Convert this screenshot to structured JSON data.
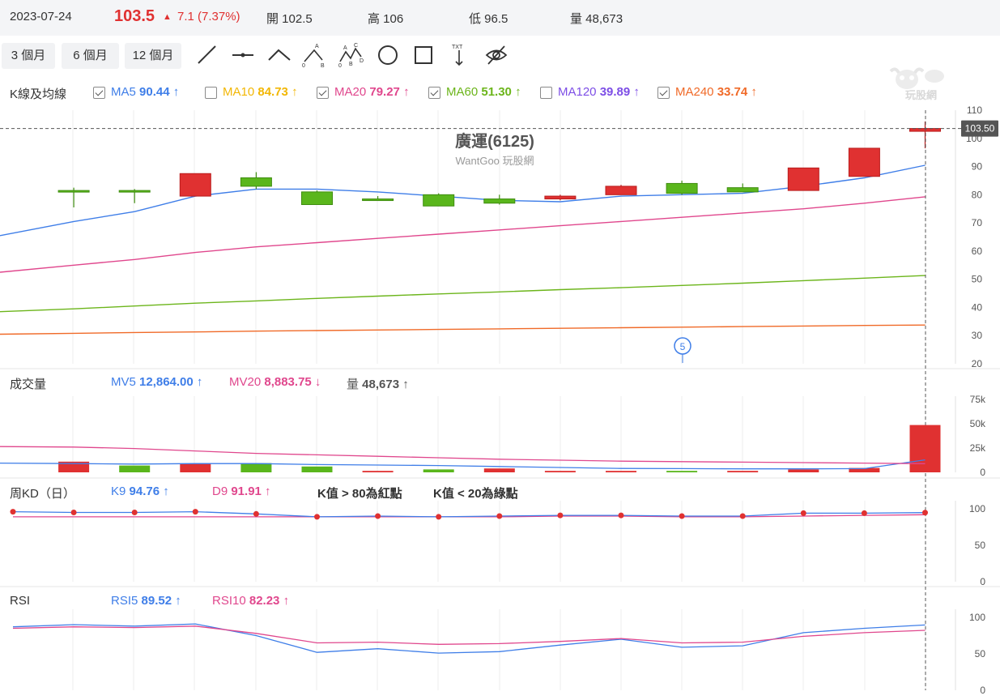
{
  "header": {
    "date": "2023-07-24",
    "price": "103.5",
    "change": "7.1 (7.37%)",
    "open": "開 102.5",
    "high": "高 106",
    "low": "低 96.5",
    "volume": "量 48,673"
  },
  "colors": {
    "up": "#e03131",
    "down": "#5ab61c",
    "ma5": "#3f7ee8",
    "ma20": "#e0478d",
    "ma60": "#6cb51b",
    "ma240": "#f06a28",
    "ma10": "#f2b705",
    "ma120": "#7d4ee6",
    "k": "#3f7ee8",
    "d": "#e0478d",
    "rsi5": "#3f7ee8",
    "rsi10": "#e0478d"
  },
  "toolbar": {
    "periods": [
      "3 個月",
      "6 個月",
      "12 個月"
    ],
    "tools": [
      "trend-line-icon",
      "horizontal-line-icon",
      "angle-line-icon",
      "abc-pattern-icon",
      "abcd-pattern-icon",
      "circle-icon",
      "rectangle-icon",
      "text-icon",
      "hide-icon"
    ]
  },
  "ma_legend": {
    "title": "K線及均線",
    "items": [
      {
        "label": "MA5",
        "value": "90.44",
        "arrow": "↑",
        "checked": true,
        "color": "#3f7ee8"
      },
      {
        "label": "MA10",
        "value": "84.73",
        "arrow": "↑",
        "checked": false,
        "color": "#f2b705"
      },
      {
        "label": "MA20",
        "value": "79.27",
        "arrow": "↑",
        "checked": true,
        "color": "#e0478d"
      },
      {
        "label": "MA60",
        "value": "51.30",
        "arrow": "↑",
        "checked": true,
        "color": "#6cb51b"
      },
      {
        "label": "MA120",
        "value": "39.89",
        "arrow": "↑",
        "checked": false,
        "color": "#7d4ee6"
      },
      {
        "label": "MA240",
        "value": "33.74",
        "arrow": "↑",
        "checked": true,
        "color": "#f06a28"
      }
    ]
  },
  "watermark": {
    "text": "玩股網"
  },
  "chart_data": [
    {
      "type": "candlestick",
      "title": "廣運(6125)",
      "subtitle": "WantGoo 玩股網",
      "ylim": [
        20,
        110
      ],
      "yticks": [
        110,
        100,
        90,
        80,
        70,
        60,
        50,
        40,
        30,
        20
      ],
      "last_price_label": "103.50",
      "last_price": 103.5,
      "event_marker": "5",
      "candles": [
        {
          "o": 81.5,
          "h": 82.5,
          "l": 75.5,
          "c": 81
        },
        {
          "o": 81.5,
          "h": 82,
          "l": 77,
          "c": 81
        },
        {
          "o": 79.5,
          "h": 87.5,
          "l": 79.5,
          "c": 87.5
        },
        {
          "o": 86,
          "h": 88,
          "l": 82,
          "c": 83
        },
        {
          "o": 81,
          "h": 81.5,
          "l": 76.5,
          "c": 76.5
        },
        {
          "o": 78.5,
          "h": 79.5,
          "l": 78,
          "c": 78.3
        },
        {
          "o": 80,
          "h": 80.5,
          "l": 76,
          "c": 76
        },
        {
          "o": 78.5,
          "h": 80,
          "l": 76.5,
          "c": 77
        },
        {
          "o": 78.5,
          "h": 80,
          "l": 78,
          "c": 79.5
        },
        {
          "o": 80,
          "h": 83.5,
          "l": 80,
          "c": 83
        },
        {
          "o": 84,
          "h": 85,
          "l": 80,
          "c": 80.5
        },
        {
          "o": 82.5,
          "h": 84,
          "l": 81,
          "c": 81
        },
        {
          "o": 81.5,
          "h": 89.5,
          "l": 81.5,
          "c": 89.5
        },
        {
          "o": 86.5,
          "h": 96.5,
          "l": 86.5,
          "c": 96.5
        },
        {
          "o": 102.5,
          "h": 106,
          "l": 96.5,
          "c": 103.5
        }
      ],
      "series": [
        {
          "name": "MA5",
          "values": [
            65.5,
            70.5,
            74,
            79.5,
            82,
            82,
            81,
            79.5,
            78,
            77.5,
            79.5,
            80,
            80.5,
            83,
            86,
            90.44
          ]
        },
        {
          "name": "MA20",
          "values": [
            52.5,
            55,
            57,
            59.5,
            61.5,
            63,
            64.5,
            66,
            67.5,
            69,
            70.5,
            72,
            73.5,
            75,
            77,
            79.27
          ]
        },
        {
          "name": "MA60",
          "values": [
            38.5,
            39.5,
            40.5,
            41.5,
            42.3,
            43.2,
            44,
            44.8,
            45.5,
            46.3,
            47,
            47.8,
            48.6,
            49.5,
            50.4,
            51.3
          ]
        },
        {
          "name": "MA240",
          "values": [
            30.5,
            30.8,
            31.1,
            31.3,
            31.6,
            31.8,
            32,
            32.2,
            32.4,
            32.6,
            32.8,
            33,
            33.2,
            33.4,
            33.6,
            33.74
          ]
        }
      ]
    },
    {
      "type": "bar",
      "title": "成交量",
      "legend": [
        {
          "label": "MV5",
          "value": "12,864.00",
          "arrow": "↑",
          "color": "#3f7ee8"
        },
        {
          "label": "MV20",
          "value": "8,883.75",
          "arrow": "↓",
          "color": "#e0478d"
        },
        {
          "label": "量",
          "value": "48,673",
          "arrow": "↑",
          "color": "#555555"
        }
      ],
      "ylim": [
        0,
        75000
      ],
      "yticks": [
        "75k",
        "50k",
        "25k",
        "0"
      ],
      "yticks_values": [
        75000,
        50000,
        25000,
        0
      ],
      "values": [
        11000,
        7000,
        9000,
        9500,
        6000,
        1500,
        3000,
        4000,
        1500,
        1500,
        1500,
        1500,
        3000,
        4500,
        48673
      ],
      "directions": [
        "up",
        "down",
        "up",
        "down",
        "down",
        "up",
        "down",
        "up",
        "up",
        "up",
        "down",
        "up",
        "up",
        "up",
        "up"
      ],
      "series": [
        {
          "name": "MV5",
          "values": [
            9500,
            9000,
            8500,
            9000,
            9000,
            8000,
            7500,
            7000,
            6000,
            5000,
            4000,
            3800,
            3600,
            3600,
            3800,
            12864
          ]
        },
        {
          "name": "MV20",
          "values": [
            26500,
            26000,
            24500,
            22000,
            19500,
            18000,
            16500,
            15000,
            13500,
            12500,
            11500,
            11000,
            10500,
            10000,
            9500,
            8883.75
          ]
        }
      ]
    },
    {
      "type": "line",
      "title": "周KD（日）",
      "legend": [
        {
          "label": "K9",
          "value": "94.76",
          "arrow": "↑",
          "color": "#3f7ee8"
        },
        {
          "label": "D9",
          "value": "91.91",
          "arrow": "↑",
          "color": "#e0478d"
        }
      ],
      "notes": [
        "K值 > 80為紅點",
        "K值 < 20為綠點"
      ],
      "ylim": [
        0,
        100
      ],
      "yticks": [
        100,
        50,
        0
      ],
      "series": [
        {
          "name": "K9",
          "values": [
            96,
            95,
            95,
            96,
            93,
            89,
            90,
            89,
            90,
            91,
            91,
            90,
            90,
            94,
            94,
            94.76
          ]
        },
        {
          "name": "D9",
          "values": [
            89,
            89,
            89,
            89,
            89,
            89,
            89,
            89,
            89,
            90,
            90,
            89,
            89,
            90,
            91,
            91.91
          ]
        }
      ]
    },
    {
      "type": "line",
      "title": "RSI",
      "legend": [
        {
          "label": "RSI5",
          "value": "89.52",
          "arrow": "↑",
          "color": "#3f7ee8"
        },
        {
          "label": "RSI10",
          "value": "82.23",
          "arrow": "↑",
          "color": "#e0478d"
        }
      ],
      "ylim": [
        0,
        100
      ],
      "yticks": [
        100,
        50,
        0
      ],
      "series": [
        {
          "name": "RSI5",
          "values": [
            87,
            90,
            88,
            91,
            75,
            52,
            57,
            51,
            53,
            62,
            70,
            59,
            61,
            79,
            85,
            89.52
          ]
        },
        {
          "name": "RSI10",
          "values": [
            85,
            87,
            86,
            88,
            78,
            65,
            66,
            63,
            64,
            67,
            71,
            65,
            66,
            74,
            79,
            82.23
          ]
        }
      ]
    }
  ]
}
